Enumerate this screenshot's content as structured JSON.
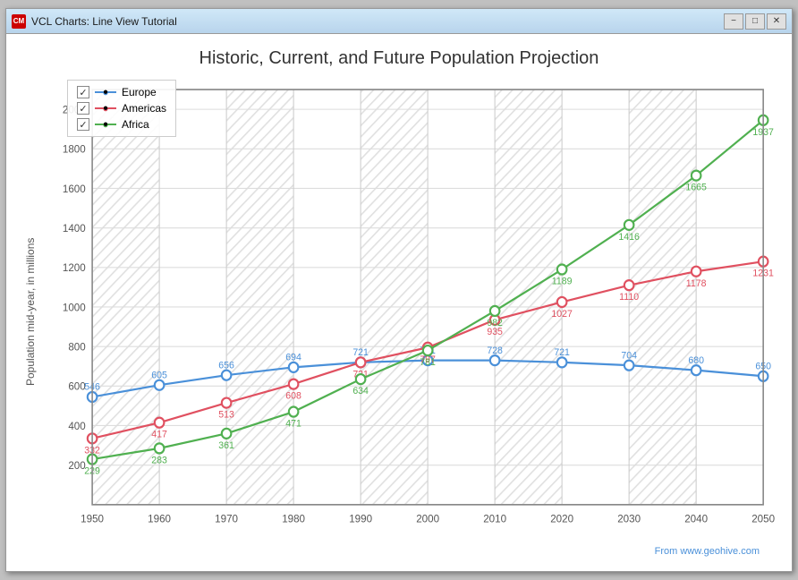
{
  "window": {
    "title": "VCL Charts: Line View Tutorial",
    "icon": "CM"
  },
  "titlebar": {
    "minimize_label": "−",
    "maximize_label": "□",
    "close_label": "✕"
  },
  "chart": {
    "title": "Historic, Current, and Future Population Projection",
    "y_axis_label": "Population mid-year, in millions",
    "source": "From www.geohive.com",
    "legend": [
      {
        "id": "europe",
        "label": "Europe",
        "color": "#4a90d9",
        "checked": true
      },
      {
        "id": "americas",
        "label": "Americas",
        "color": "#e05060",
        "checked": true
      },
      {
        "id": "africa",
        "label": "Africa",
        "color": "#50b050",
        "checked": true
      }
    ],
    "x_labels": [
      "1950",
      "1960",
      "1970",
      "1980",
      "1990",
      "2000",
      "2010",
      "2020",
      "2030",
      "2040",
      "2050"
    ],
    "y_labels": [
      "200",
      "400",
      "600",
      "800",
      "1000",
      "1200",
      "1400",
      "1600",
      "1800",
      "2000"
    ],
    "series": {
      "europe": {
        "color": "#4a90d9",
        "points": [
          {
            "year": 1950,
            "value": 546
          },
          {
            "year": 1960,
            "value": 605
          },
          {
            "year": 1970,
            "value": 656
          },
          {
            "year": 1980,
            "value": 694
          },
          {
            "year": 1990,
            "value": 721
          },
          {
            "year": 2000,
            "value": 731
          },
          {
            "year": 2010,
            "value": 728
          },
          {
            "year": 2020,
            "value": 721
          },
          {
            "year": 2030,
            "value": 704
          },
          {
            "year": 2040,
            "value": 680
          },
          {
            "year": 2050,
            "value": 650
          }
        ]
      },
      "americas": {
        "color": "#e05060",
        "points": [
          {
            "year": 1950,
            "value": 332
          },
          {
            "year": 1960,
            "value": 417
          },
          {
            "year": 1970,
            "value": 513
          },
          {
            "year": 1980,
            "value": 608
          },
          {
            "year": 1990,
            "value": 721
          },
          {
            "year": 2000,
            "value": 797
          },
          {
            "year": 2010,
            "value": 935
          },
          {
            "year": 2020,
            "value": 1027
          },
          {
            "year": 2030,
            "value": 1110
          },
          {
            "year": 2040,
            "value": 1178
          },
          {
            "year": 2050,
            "value": 1231
          }
        ]
      },
      "africa": {
        "color": "#50b050",
        "points": [
          {
            "year": 1950,
            "value": 229
          },
          {
            "year": 1960,
            "value": 283
          },
          {
            "year": 1970,
            "value": 361
          },
          {
            "year": 1980,
            "value": 471
          },
          {
            "year": 1990,
            "value": 634
          },
          {
            "year": 2000,
            "value": 781
          },
          {
            "year": 2010,
            "value": 982
          },
          {
            "year": 2020,
            "value": 1189
          },
          {
            "year": 2030,
            "value": 1416
          },
          {
            "year": 2040,
            "value": 1665
          },
          {
            "year": 2050,
            "value": 1937
          }
        ]
      }
    }
  }
}
